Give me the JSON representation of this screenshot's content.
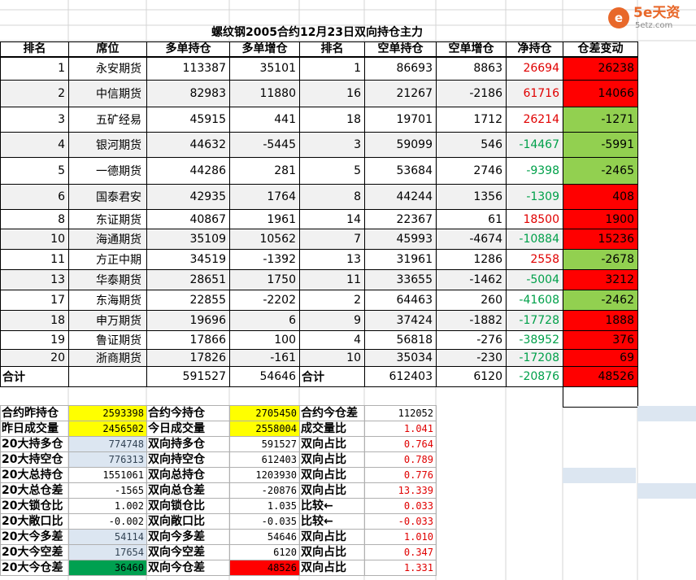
{
  "title": "螺纹钢2005合约12月23日双向持仓主力",
  "logo": {
    "mark": "e",
    "brand": "5e天资",
    "url": "5etz.com"
  },
  "headers": [
    "排名",
    "席位",
    "多单持仓",
    "多单增仓",
    "排名",
    "空单持仓",
    "空单增仓",
    "净持仓",
    "仓差变动"
  ],
  "rows": [
    [
      "1",
      "永安期货",
      "113387",
      "35101",
      "1",
      "86693",
      "8863",
      "26694",
      "26238"
    ],
    [
      "2",
      "中信期货",
      "82983",
      "11880",
      "16",
      "21267",
      "-2186",
      "61716",
      "14066"
    ],
    [
      "3",
      "五矿经易",
      "45915",
      "441",
      "18",
      "19701",
      "1712",
      "26214",
      "-1271"
    ],
    [
      "4",
      "银河期货",
      "44632",
      "-5445",
      "3",
      "59099",
      "546",
      "-14467",
      "-5991"
    ],
    [
      "5",
      "一德期货",
      "44286",
      "281",
      "5",
      "53684",
      "2746",
      "-9398",
      "-2465"
    ],
    [
      "6",
      "国泰君安",
      "42935",
      "1764",
      "8",
      "44244",
      "1356",
      "-1309",
      "408"
    ],
    [
      "8",
      "东证期货",
      "40867",
      "1961",
      "14",
      "22367",
      "61",
      "18500",
      "1900"
    ],
    [
      "10",
      "海通期货",
      "35109",
      "10562",
      "7",
      "45993",
      "-4674",
      "-10884",
      "15236"
    ],
    [
      "11",
      "方正中期",
      "34519",
      "-1392",
      "13",
      "31961",
      "1286",
      "2558",
      "-2678"
    ],
    [
      "13",
      "华泰期货",
      "28651",
      "1750",
      "11",
      "33655",
      "-1462",
      "-5004",
      "3212"
    ],
    [
      "17",
      "东海期货",
      "22855",
      "-2202",
      "2",
      "64463",
      "260",
      "-41608",
      "-2462"
    ],
    [
      "18",
      "申万期货",
      "19696",
      "6",
      "9",
      "37424",
      "-1882",
      "-17728",
      "1888"
    ],
    [
      "19",
      "鲁证期货",
      "17866",
      "100",
      "4",
      "56818",
      "-276",
      "-38952",
      "376"
    ],
    [
      "20",
      "浙商期货",
      "17826",
      "-161",
      "10",
      "35034",
      "-230",
      "-17208",
      "69"
    ]
  ],
  "total": {
    "label": "合计",
    "long": "591527",
    "long_add": "54646",
    "label2": "合计",
    "short": "612403",
    "short_add": "6120",
    "net": "-20876",
    "change": "48526"
  },
  "summary": [
    [
      "合约昨持仓",
      "2593398",
      "合约今持仓",
      "2705450",
      "合约今仓差",
      "112052"
    ],
    [
      "昨日成交量",
      "2456502",
      "今日成交量",
      "2558004",
      "成交量比",
      "1.041"
    ],
    [
      "20大持多仓",
      "774748",
      "双向持多仓",
      "591527",
      "双向占比",
      "0.764"
    ],
    [
      "20大持空仓",
      "776313",
      "双向持空仓",
      "612403",
      "双向占比",
      "0.789"
    ],
    [
      "20大总持仓",
      "1551061",
      "双向总持仓",
      "1203930",
      "双向占比",
      "0.776"
    ],
    [
      "20大总仓差",
      "-1565",
      "双向总仓差",
      "-20876",
      "双向占比",
      "13.339"
    ],
    [
      "20大锁仓比",
      "1.002",
      "双向锁仓比",
      "1.035",
      "比较←",
      "0.033"
    ],
    [
      "20大敞口比",
      "-0.002",
      "双向敞口比",
      "-0.035",
      "比较←",
      "-0.033"
    ],
    [
      "20大今多差",
      "54114",
      "双向今多差",
      "54646",
      "双向占比",
      "1.010"
    ],
    [
      "20大今空差",
      "17654",
      "双向今空差",
      "6120",
      "双向占比",
      "0.347"
    ],
    [
      "20大今仓差",
      "36460",
      "双向今仓差",
      "48526",
      "双向占比",
      "1.331"
    ]
  ]
}
